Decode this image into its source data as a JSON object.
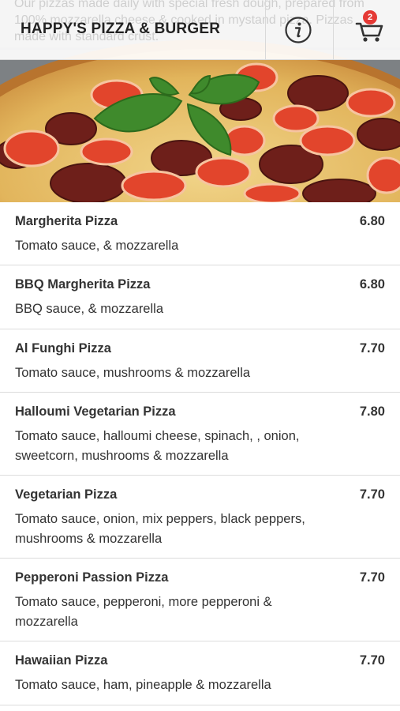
{
  "header": {
    "title": "HAPPY'S PIZZA & BURGER",
    "background_text": "Our pizzas made daily with special fresh dough, prepared from 100% mozzarella cheese & cooked in mystand pizza. Pizzas made with standard crust.",
    "info_icon": "info-icon",
    "cart_icon": "shopping-cart-icon",
    "cart_count": "2"
  },
  "colors": {
    "badge": "#e53935",
    "text": "#333333",
    "divider": "#dcdcdc"
  },
  "menu": {
    "items": [
      {
        "name": "Margherita Pizza",
        "price": "6.80",
        "description": "Tomato sauce, & mozzarella"
      },
      {
        "name": "BBQ Margherita Pizza",
        "price": "6.80",
        "description": "BBQ sauce, & mozzarella"
      },
      {
        "name": "Al Funghi Pizza",
        "price": "7.70",
        "description": "Tomato sauce, mushrooms & mozzarella"
      },
      {
        "name": "Halloumi Vegetarian Pizza",
        "price": "7.80",
        "description": "Tomato sauce, halloumi cheese, spinach, , onion, sweetcorn, mushrooms & mozzarella"
      },
      {
        "name": "Vegetarian Pizza",
        "price": "7.70",
        "description": "Tomato sauce, onion, mix peppers, black peppers, mushrooms & mozzarella"
      },
      {
        "name": "Pepperoni Passion Pizza",
        "price": "7.70",
        "description": "Tomato sauce, pepperoni, more pepperoni & mozzarella"
      },
      {
        "name": "Hawaiian Pizza",
        "price": "7.70",
        "description": "Tomato sauce, ham, pineapple & mozzarella"
      }
    ]
  }
}
